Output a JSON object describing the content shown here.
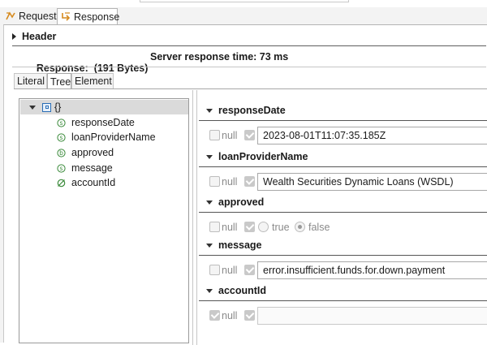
{
  "tabs": {
    "request": "Request",
    "response": "Response"
  },
  "header": {
    "label": "Header"
  },
  "response_info": {
    "size": "Response:  (191 Bytes)",
    "server_time": "Server response time: 73 ms"
  },
  "view_tabs": {
    "literal": "Literal",
    "tree": "Tree",
    "element": "Element"
  },
  "tree": {
    "root": "{}",
    "items": [
      {
        "label": "responseDate",
        "type": "string"
      },
      {
        "label": "loanProviderName",
        "type": "string"
      },
      {
        "label": "approved",
        "type": "boolean"
      },
      {
        "label": "message",
        "type": "string"
      },
      {
        "label": "accountId",
        "type": "null"
      }
    ]
  },
  "fields": {
    "responseDate": {
      "title": "responseDate",
      "null_label": "null",
      "value": "2023-08-01T11:07:35.185Z"
    },
    "loanProviderName": {
      "title": "loanProviderName",
      "null_label": "null",
      "value": "Wealth Securities Dynamic Loans (WSDL)"
    },
    "approved": {
      "title": "approved",
      "null_label": "null",
      "true_label": "true",
      "false_label": "false",
      "selected": "false"
    },
    "message": {
      "title": "message",
      "null_label": "null",
      "value": "error.insufficient.funds.for.down.payment"
    },
    "accountId": {
      "title": "accountId",
      "null_label": "null",
      "value": ""
    }
  },
  "colors": {
    "selection": "#dadada",
    "string_icon": "#3a8a3a",
    "null_icon": "#3a8a3a",
    "object_icon": "#2a6db5"
  }
}
